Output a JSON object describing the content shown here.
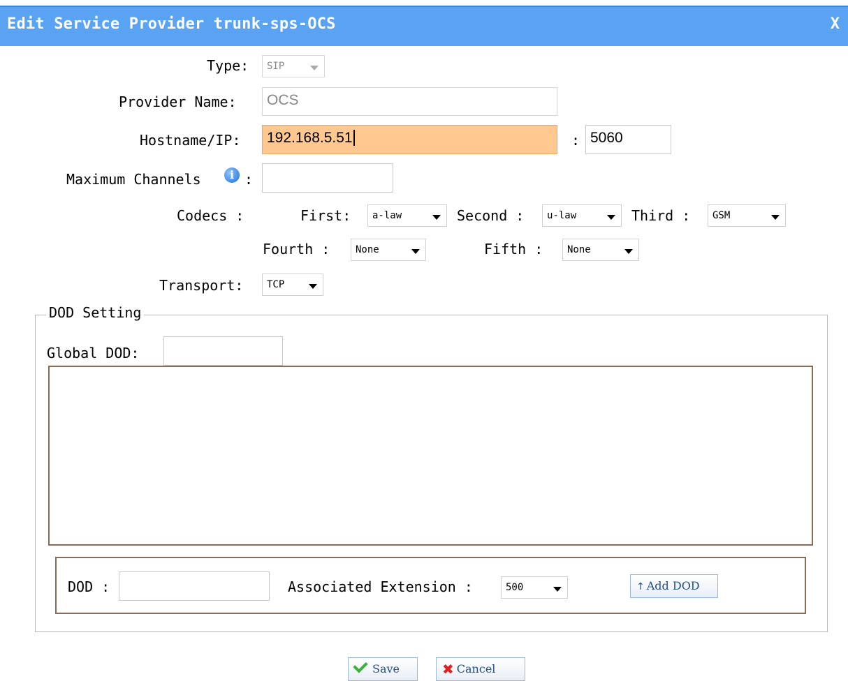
{
  "dialog": {
    "title": "Edit Service Provider trunk-sps-OCS",
    "close_label": "X"
  },
  "form": {
    "type_label": "Type:",
    "type_value": "SIP",
    "provider_name_label": "Provider Name:",
    "provider_name_value": "OCS",
    "hostname_label": "Hostname/IP:",
    "hostname_value": "192.168.5.51",
    "port_separator": ":",
    "port_value": "5060",
    "max_channels_label": "Maximum Channels",
    "max_channels_colon": ":",
    "max_channels_value": "",
    "codecs_label": "Codecs :",
    "first_label": "First:",
    "first_value": "a-law",
    "second_label": "Second :",
    "second_value": "u-law",
    "third_label": "Third :",
    "third_value": "GSM",
    "fourth_label": "Fourth :",
    "fourth_value": "None",
    "fifth_label": "Fifth :",
    "fifth_value": "None",
    "transport_label": "Transport:",
    "transport_value": "TCP"
  },
  "dod": {
    "legend": "DOD Setting",
    "global_dod_label": "Global DOD:",
    "global_dod_value": "",
    "dod_label": "DOD :",
    "dod_value": "",
    "associated_extension_label": "Associated Extension :",
    "associated_extension_value": "500",
    "add_dod_label": "Add DOD"
  },
  "footer": {
    "save_label": "Save",
    "cancel_label": "Cancel"
  },
  "colors": {
    "titlebar": "#5aa3f2",
    "active_field": "#ffc891",
    "box_border": "#8b6b55"
  }
}
